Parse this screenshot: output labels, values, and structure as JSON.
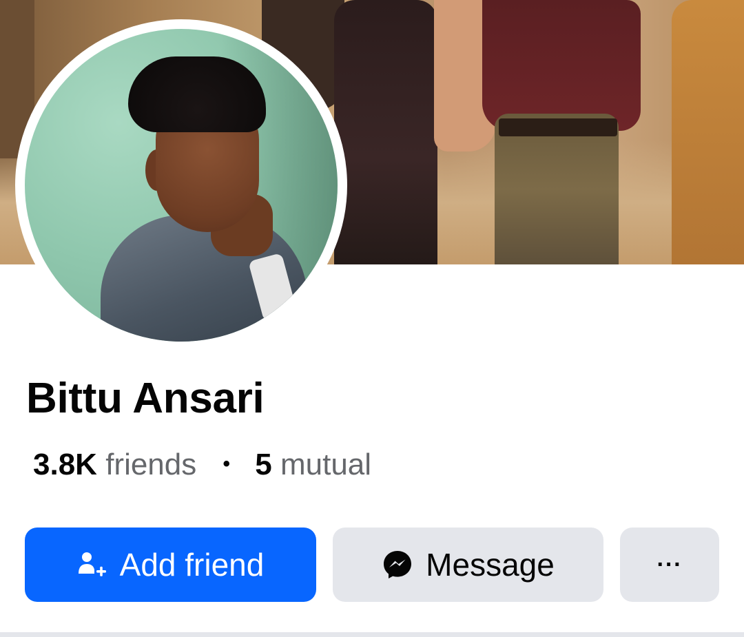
{
  "profile": {
    "name": "Bittu Ansari",
    "friends_count": "3.8K",
    "friends_label": "friends",
    "separator": "•",
    "mutual_count": "5",
    "mutual_label": "mutual"
  },
  "actions": {
    "add_friend_label": "Add friend",
    "add_friend_icon": "add-person-icon",
    "message_label": "Message",
    "message_icon": "messenger-icon",
    "more_label": "···"
  },
  "colors": {
    "primary_button": "#0866ff",
    "secondary_button": "#e4e6eb",
    "secondary_text": "#65676b"
  }
}
